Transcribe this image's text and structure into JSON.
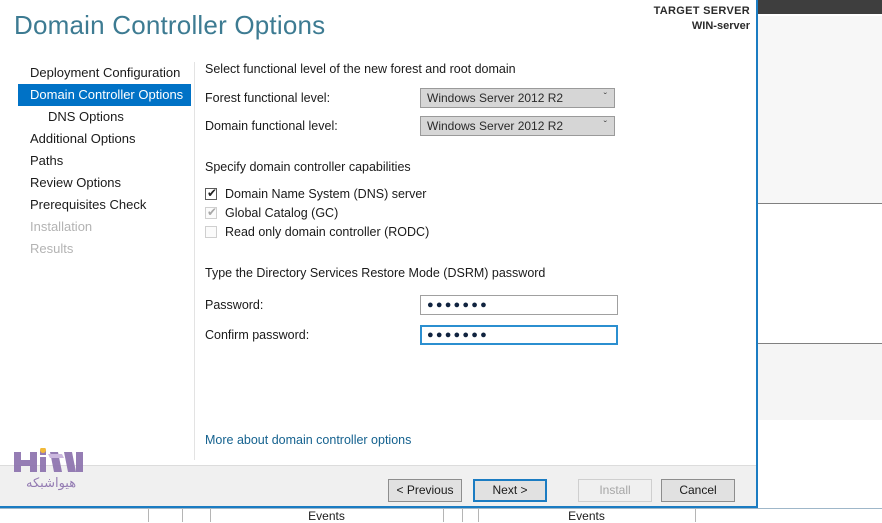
{
  "window": {
    "title": "Domain Controller Options",
    "target_server_label": "TARGET SERVER",
    "target_server_name": "WIN-server",
    "accent_color": "#0072c6",
    "title_color": "#3d7b92",
    "focus_border_color": "#1b7cc2"
  },
  "nav": {
    "items": [
      {
        "label": "Deployment Configuration",
        "state": "normal",
        "indent": false
      },
      {
        "label": "Domain Controller Options",
        "state": "selected",
        "indent": false
      },
      {
        "label": "DNS Options",
        "state": "normal",
        "indent": true
      },
      {
        "label": "Additional Options",
        "state": "normal",
        "indent": false
      },
      {
        "label": "Paths",
        "state": "normal",
        "indent": false
      },
      {
        "label": "Review Options",
        "state": "normal",
        "indent": false
      },
      {
        "label": "Prerequisites Check",
        "state": "normal",
        "indent": false
      },
      {
        "label": "Installation",
        "state": "disabled",
        "indent": false
      },
      {
        "label": "Results",
        "state": "disabled",
        "indent": false
      }
    ]
  },
  "main": {
    "functional_level": {
      "heading": "Select functional level of the new forest and root domain",
      "forest_label": "Forest functional level:",
      "forest_value": "Windows Server 2012 R2",
      "domain_label": "Domain functional level:",
      "domain_value": "Windows Server 2012 R2",
      "chevron": "ˇ"
    },
    "capabilities": {
      "heading": "Specify domain controller capabilities",
      "options": [
        {
          "label": "Domain Name System (DNS) server",
          "checked": true,
          "enabled": true
        },
        {
          "label": "Global Catalog (GC)",
          "checked": true,
          "enabled": false
        },
        {
          "label": "Read only domain controller (RODC)",
          "checked": false,
          "enabled": false
        }
      ],
      "check_glyph": "✔"
    },
    "dsrm": {
      "heading": "Type the Directory Services Restore Mode (DSRM) password",
      "password_label": "Password:",
      "password_value": "●●●●●●●",
      "confirm_label": "Confirm password:",
      "confirm_value": "●●●●●●●"
    },
    "more_link": "More about domain controller options"
  },
  "footer": {
    "previous": "< Previous",
    "next": "Next >",
    "install": "Install",
    "cancel": "Cancel"
  },
  "background": {
    "events_left": "Events",
    "events_right": "Events"
  },
  "watermark": {
    "brand": "HIVA",
    "subtitle": "هیواشبکه",
    "color": "#8d73ae"
  }
}
